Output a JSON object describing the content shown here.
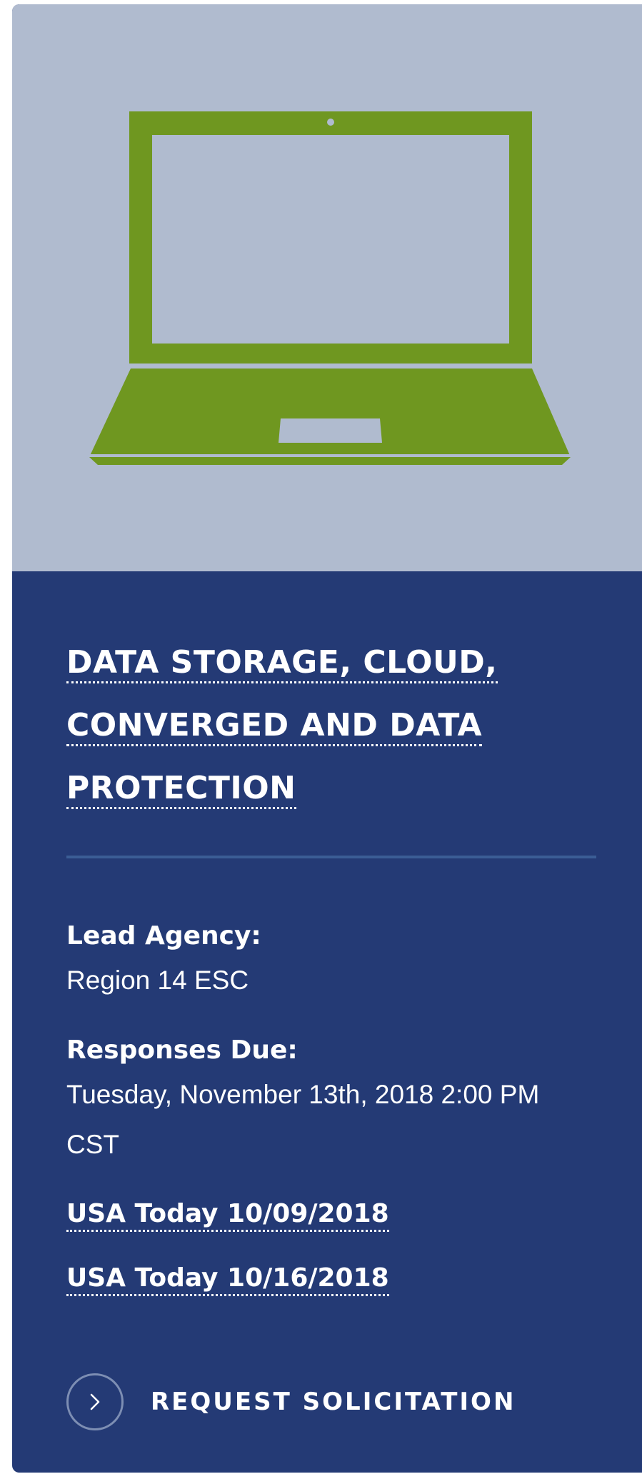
{
  "card": {
    "hero_icon": "laptop-icon",
    "title_lines": [
      "DATA STORAGE, CLOUD,",
      "CONVERGED AND DATA",
      "PROTECTION"
    ],
    "lead_agency_label": "Lead Agency:",
    "lead_agency_value": "Region 14 ESC",
    "responses_due_label": "Responses Due:",
    "responses_due_value": "Tuesday, November 13th, 2018 2:00 PM CST",
    "links": [
      "USA Today 10/09/2018",
      "USA Today 10/16/2018"
    ],
    "cta_label": "REQUEST SOLICITATION",
    "cta_icon": "chevron-right-icon"
  },
  "colors": {
    "hero_background": "#b0bbcf",
    "card_background": "#243a75",
    "laptop_green": "#6f9720",
    "divider": "#3b5d95"
  }
}
